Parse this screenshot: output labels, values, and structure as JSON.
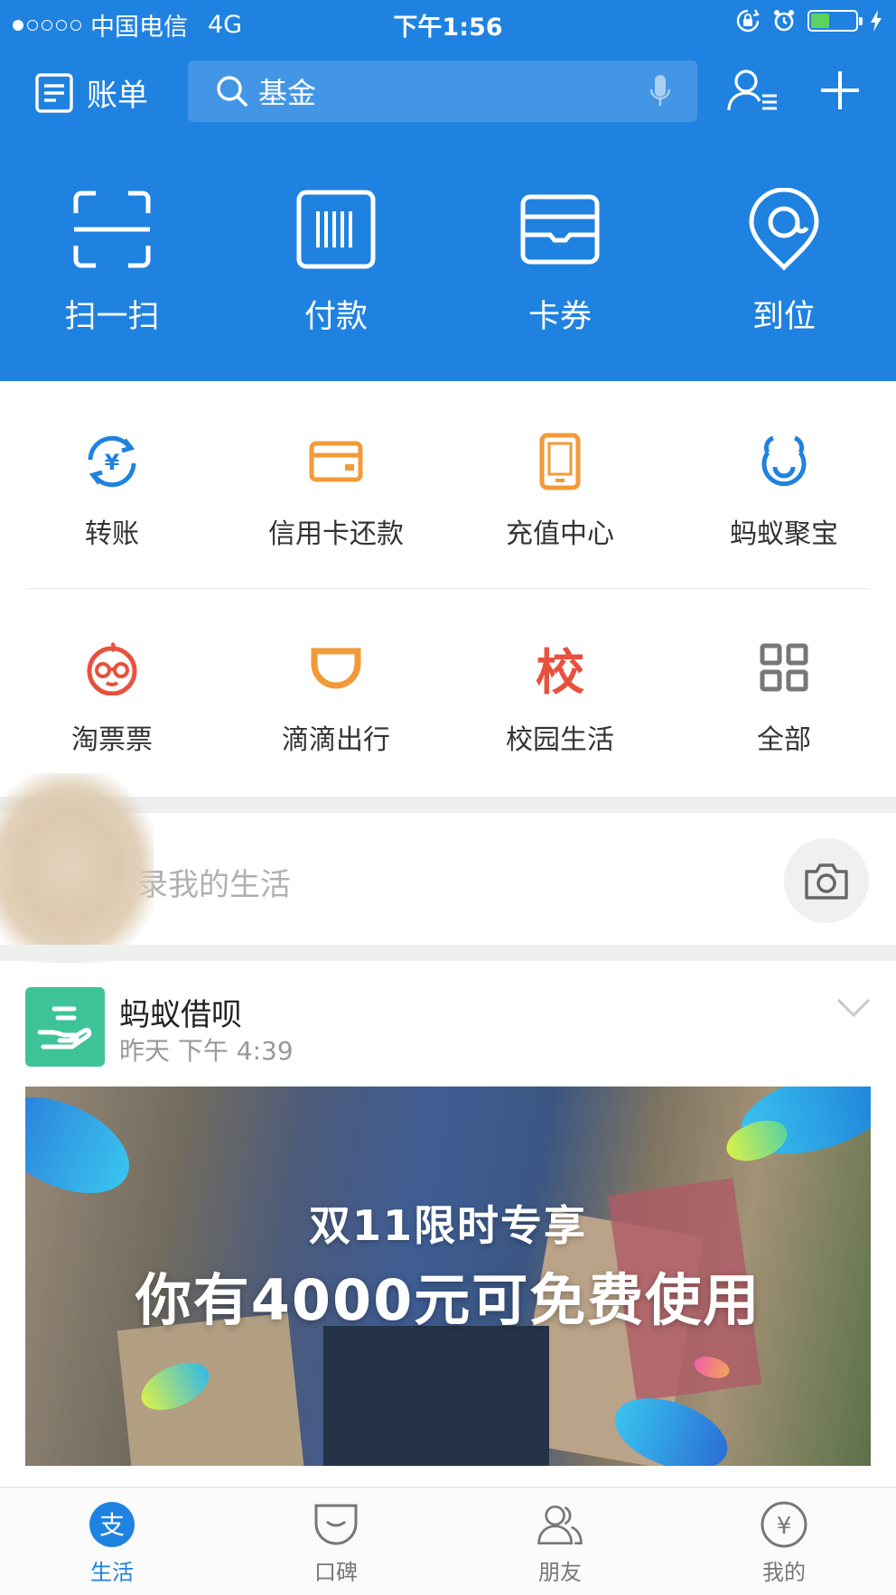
{
  "status_bar": {
    "carrier": "中国电信",
    "network": "4G",
    "time": "下午1:56"
  },
  "toolbar": {
    "bill_label": "账单",
    "search_placeholder": "基金"
  },
  "big_actions": [
    {
      "label": "扫一扫",
      "icon": "scan-icon"
    },
    {
      "label": "付款",
      "icon": "barcode-icon"
    },
    {
      "label": "卡券",
      "icon": "card-wallet-icon"
    },
    {
      "label": "到位",
      "icon": "location-pin-icon"
    }
  ],
  "grid": [
    {
      "label": "转账",
      "icon": "transfer-icon",
      "color": "#1f82e0"
    },
    {
      "label": "信用卡还款",
      "icon": "credit-card-icon",
      "color": "#f29a38"
    },
    {
      "label": "充值中心",
      "icon": "phone-icon",
      "color": "#f29a38"
    },
    {
      "label": "蚂蚁聚宝",
      "icon": "ant-fortune-icon",
      "color": "#1f82e0"
    },
    {
      "label": "淘票票",
      "icon": "taopiaopiao-icon",
      "color": "#e8513f"
    },
    {
      "label": "滴滴出行",
      "icon": "didi-icon",
      "color": "#f29a38"
    },
    {
      "label": "校园生活",
      "icon": "campus-icon",
      "color": "#e8513f",
      "glyph": "校"
    },
    {
      "label": "全部",
      "icon": "all-grid-icon",
      "color": "#777777"
    }
  ],
  "record": {
    "placeholder": "录我的生活"
  },
  "feed": {
    "title": "蚂蚁借呗",
    "time": "昨天 下午 4:39",
    "banner": {
      "subtitle": "双11限时专享",
      "headline": "你有4000元可免费使用"
    }
  },
  "tabs": [
    {
      "label": "生活",
      "icon": "life-icon",
      "active": true
    },
    {
      "label": "口碑",
      "icon": "koubei-icon",
      "active": false
    },
    {
      "label": "朋友",
      "icon": "friends-icon",
      "active": false
    },
    {
      "label": "我的",
      "icon": "mine-icon",
      "active": false
    }
  ],
  "colors": {
    "brand_blue": "#1f82e0",
    "orange": "#f29a38",
    "red": "#e8513f",
    "jiebei_green": "#3ec398"
  }
}
